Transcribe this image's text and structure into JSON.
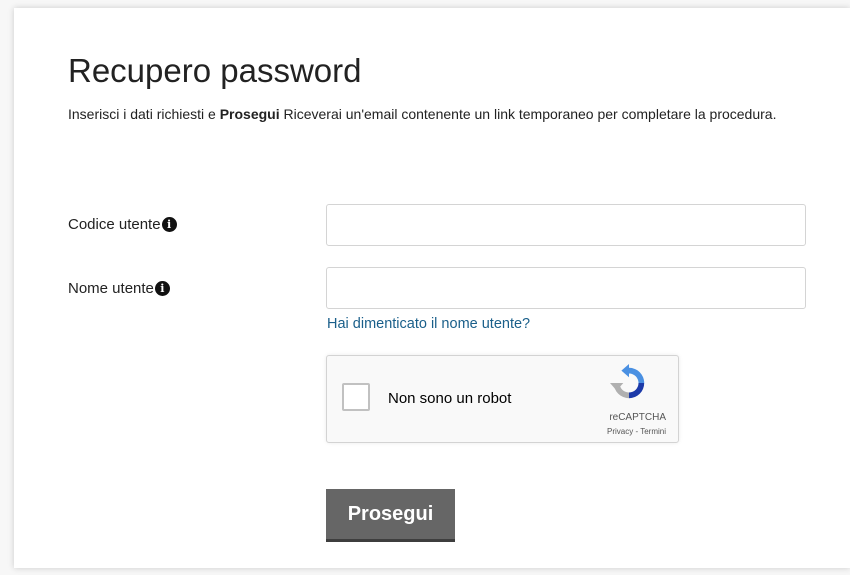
{
  "page": {
    "title": "Recupero password",
    "intro_part1": "Inserisci i dati richiesti e ",
    "intro_bold": "Prosegui",
    "intro_part2": " Riceverai un'email contenente un link temporaneo per completare la procedura."
  },
  "form": {
    "codice_label": "Codice utente",
    "codice_value": "",
    "nome_label": "Nome utente",
    "nome_value": "",
    "info_icon_glyph": "i",
    "forgot_link": "Hai dimenticato il nome utente?",
    "submit_label": "Prosegui"
  },
  "captcha": {
    "label": "Non sono un robot",
    "brand": "reCAPTCHA",
    "privacy": "Privacy",
    "separator": " - ",
    "terms": "Termini",
    "checked": false
  },
  "colors": {
    "link": "#1a5f8a",
    "button_bg": "#666666",
    "logo_blue": "#4a90e2",
    "logo_dark_blue": "#1c3aa9",
    "logo_grey": "#b0b0b0"
  }
}
